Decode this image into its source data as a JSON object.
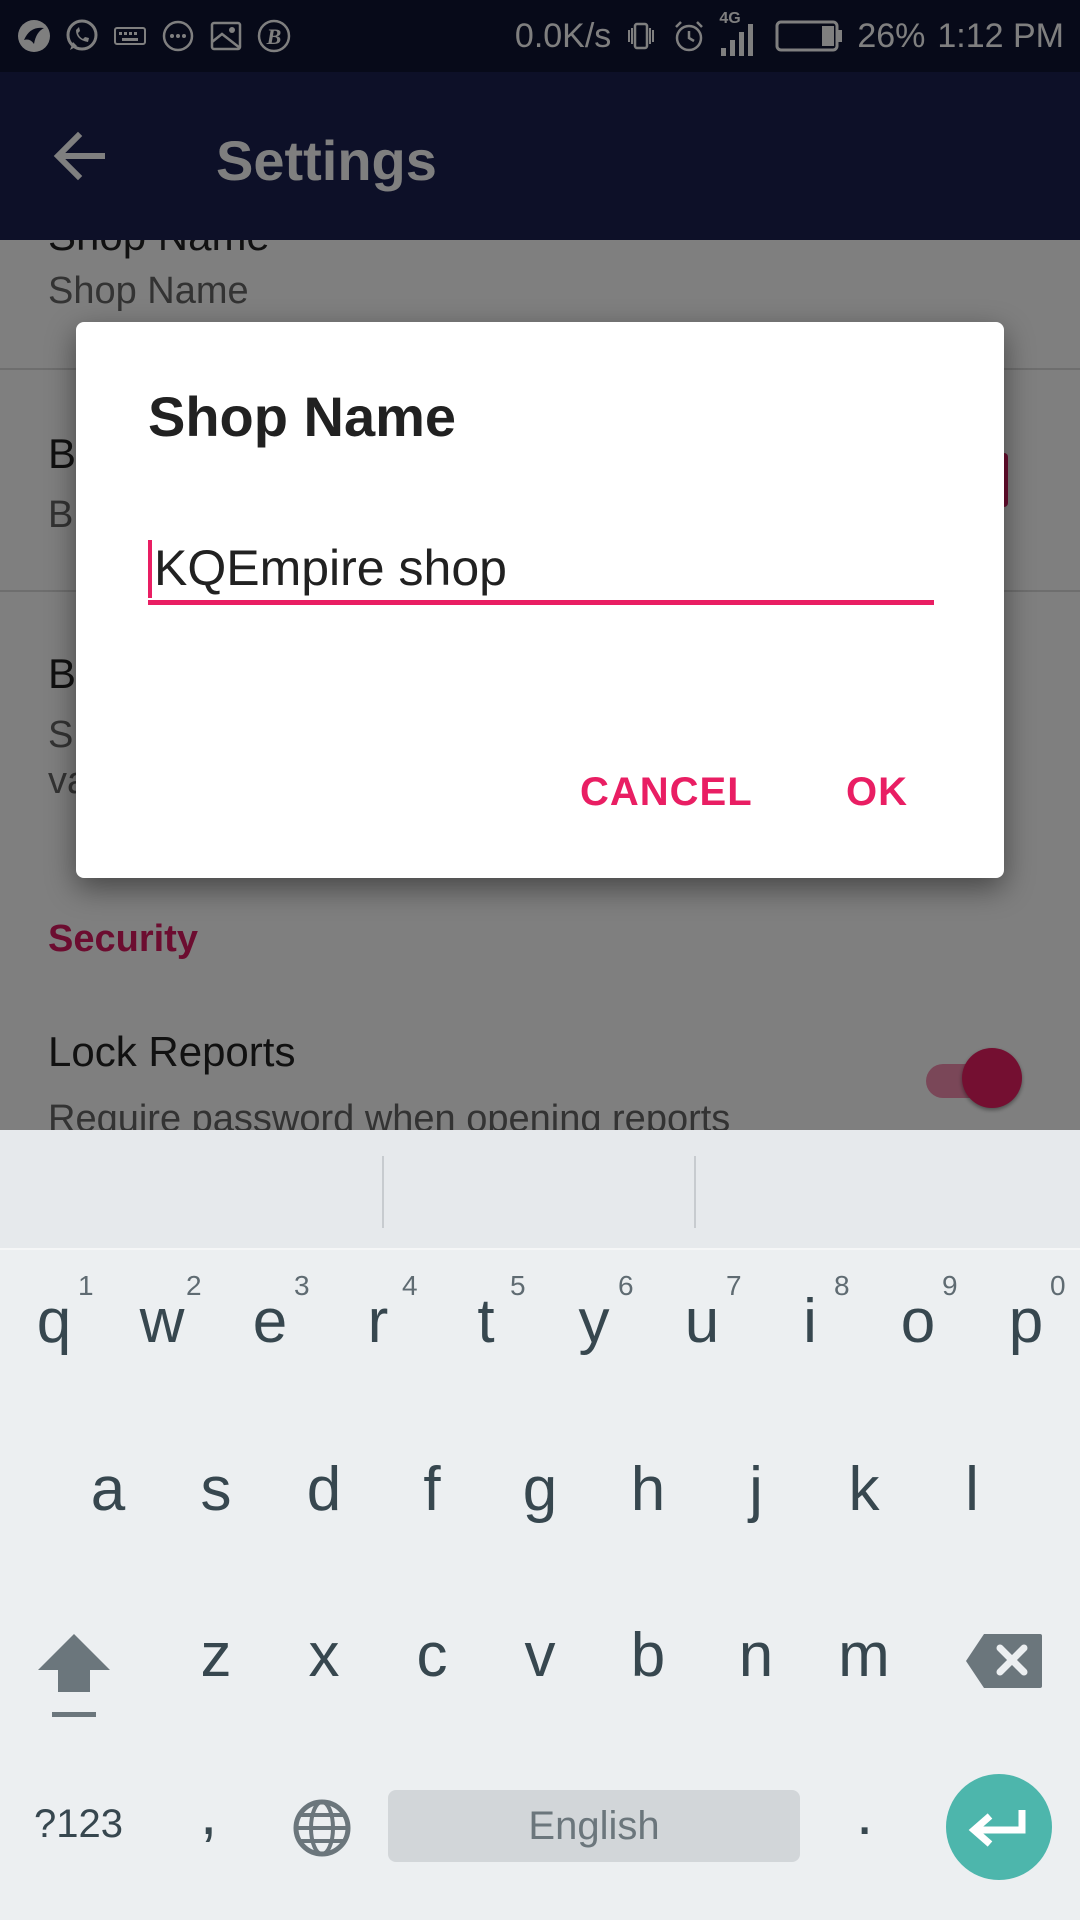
{
  "status_bar": {
    "network_speed": "0.0K/s",
    "network_type": "4G",
    "battery": "26%",
    "time": "1:12 PM",
    "icons": [
      "bird-app-icon",
      "whatsapp-icon",
      "keyboard-icon",
      "chat-icon",
      "image-icon",
      "b-app-icon",
      "vibrate-icon",
      "alarm-icon",
      "signal-icon",
      "battery-icon"
    ]
  },
  "app_bar": {
    "title": "Settings",
    "back_icon": "arrow-back-icon"
  },
  "settings": {
    "shop_name": {
      "title": "Shop Name",
      "summary": "Shop Name"
    },
    "pref_b1": {
      "title": "B",
      "summary": "B"
    },
    "pref_b2": {
      "title": "B",
      "summary_line1": "S",
      "summary_line2": "va"
    },
    "security_header": "Security",
    "lock_reports": {
      "title": "Lock Reports",
      "summary": "Require password when opening reports",
      "enabled": true
    }
  },
  "dialog": {
    "title": "Shop Name",
    "input_value": "KQEmpire shop",
    "cancel_label": "CANCEL",
    "ok_label": "OK"
  },
  "keyboard": {
    "row1": [
      {
        "char": "q",
        "hint": "1"
      },
      {
        "char": "w",
        "hint": "2"
      },
      {
        "char": "e",
        "hint": "3"
      },
      {
        "char": "r",
        "hint": "4"
      },
      {
        "char": "t",
        "hint": "5"
      },
      {
        "char": "y",
        "hint": "6"
      },
      {
        "char": "u",
        "hint": "7"
      },
      {
        "char": "i",
        "hint": "8"
      },
      {
        "char": "o",
        "hint": "9"
      },
      {
        "char": "p",
        "hint": "0"
      }
    ],
    "row2": [
      "a",
      "s",
      "d",
      "f",
      "g",
      "h",
      "j",
      "k",
      "l"
    ],
    "row3": [
      "z",
      "x",
      "c",
      "v",
      "b",
      "n",
      "m"
    ],
    "symbols_label": "?123",
    "comma": ",",
    "space_label": "English",
    "period": ".",
    "icons": [
      "shift-icon",
      "backspace-icon",
      "globe-icon",
      "enter-icon"
    ]
  },
  "colors": {
    "accent": "#e91e63",
    "app_bar": "#1a2050",
    "status_bar": "#0e1433",
    "enter_key": "#4db6ac"
  }
}
